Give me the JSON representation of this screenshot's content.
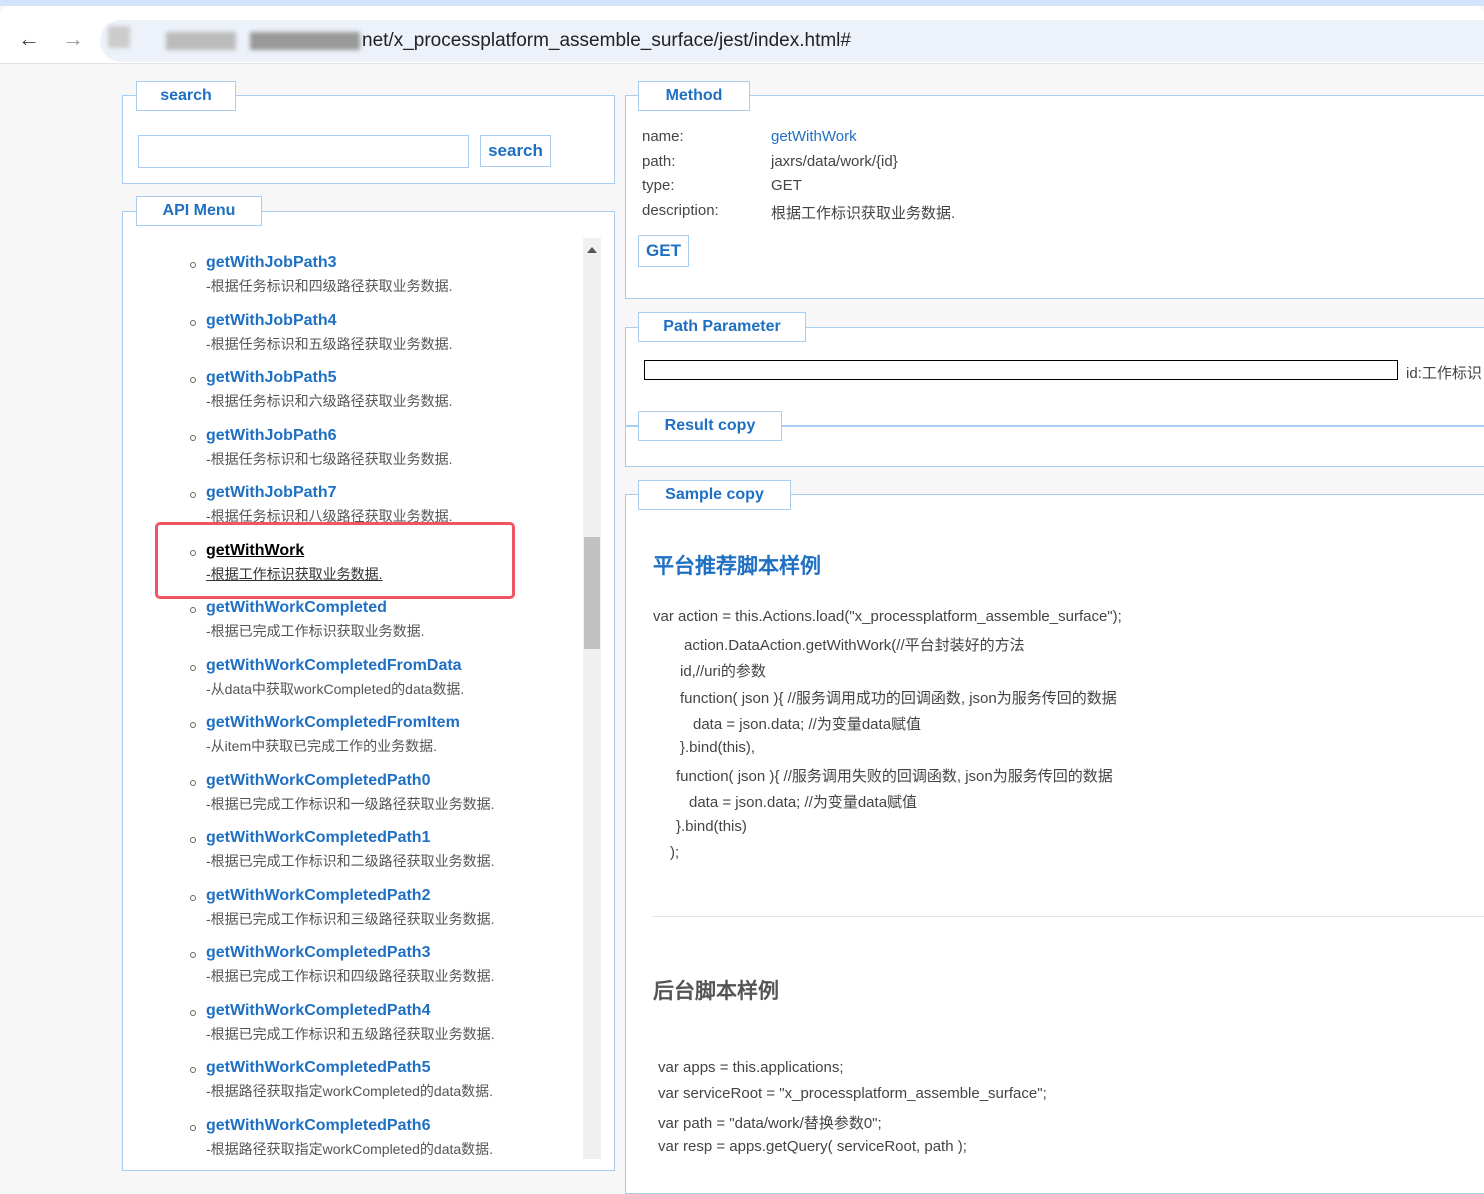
{
  "browser": {
    "url_visible": "net/x_processplatform_assemble_surface/jest/index.html#",
    "back_icon": "←",
    "forward_icon": "→"
  },
  "search": {
    "legend": "search",
    "input_value": "",
    "button": "search"
  },
  "menu": {
    "legend": "API Menu",
    "items": [
      {
        "name": "getWithJobPath3",
        "desc": "-根据任务标识和四级路径获取业务数据."
      },
      {
        "name": "getWithJobPath4",
        "desc": "-根据任务标识和五级路径获取业务数据."
      },
      {
        "name": "getWithJobPath5",
        "desc": "-根据任务标识和六级路径获取业务数据."
      },
      {
        "name": "getWithJobPath6",
        "desc": "-根据任务标识和七级路径获取业务数据."
      },
      {
        "name": "getWithJobPath7",
        "desc": "-根据任务标识和八级路径获取业务数据."
      },
      {
        "name": "getWithWork",
        "desc": "-根据工作标识获取业务数据.",
        "selected": true
      },
      {
        "name": "getWithWorkCompleted",
        "desc": "-根据已完成工作标识获取业务数据."
      },
      {
        "name": "getWithWorkCompletedFromData",
        "desc": "-从data中获取workCompleted的data数据."
      },
      {
        "name": "getWithWorkCompletedFromItem",
        "desc": "-从item中获取已完成工作的业务数据."
      },
      {
        "name": "getWithWorkCompletedPath0",
        "desc": "-根据已完成工作标识和一级路径获取业务数据."
      },
      {
        "name": "getWithWorkCompletedPath1",
        "desc": "-根据已完成工作标识和二级路径获取业务数据."
      },
      {
        "name": "getWithWorkCompletedPath2",
        "desc": "-根据已完成工作标识和三级路径获取业务数据."
      },
      {
        "name": "getWithWorkCompletedPath3",
        "desc": "-根据已完成工作标识和四级路径获取业务数据."
      },
      {
        "name": "getWithWorkCompletedPath4",
        "desc": "-根据已完成工作标识和五级路径获取业务数据."
      },
      {
        "name": "getWithWorkCompletedPath5",
        "desc": "-根据路径获取指定workCompleted的data数据."
      },
      {
        "name": "getWithWorkCompletedPath6",
        "desc": "-根据路径获取指定workCompleted的data数据."
      }
    ]
  },
  "method": {
    "legend": "Method",
    "name_label": "name:",
    "name": "getWithWork",
    "path_label": "path:",
    "path": "jaxrs/data/work/{id}",
    "type_label": "type:",
    "type": "GET",
    "desc_label": "description:",
    "desc": "根据工作标识获取业务数据.",
    "button": "GET"
  },
  "path_param": {
    "legend": "Path Parameter",
    "input_value": "",
    "label": "id:工作标识"
  },
  "result": {
    "legend": "Result copy"
  },
  "sample": {
    "legend": "Sample copy",
    "title1": "平台推荐脚本样例",
    "code1": [
      "var action = this.Actions.load(\"x_processplatform_assemble_surface\");",
      "action.DataAction.getWithWork(//平台封装好的方法",
      "id,//uri的参数",
      "function( json ){ //服务调用成功的回调函数, json为服务传回的数据",
      "data = json.data; //为变量data赋值",
      "}.bind(this),",
      "function( json ){ //服务调用失败的回调函数, json为服务传回的数据",
      "data = json.data; //为变量data赋值",
      "}.bind(this)",
      ");"
    ],
    "title2": "后台脚本样例",
    "code2": [
      "var apps = this.applications;",
      "var serviceRoot = \"x_processplatform_assemble_surface\";",
      "var path = \"data/work/替换参数0\";",
      "var resp = apps.getQuery( serviceRoot, path );"
    ]
  },
  "colors": {
    "accent": "#1f6fc2",
    "border": "#a9cdee",
    "highlight": "#f05565"
  }
}
